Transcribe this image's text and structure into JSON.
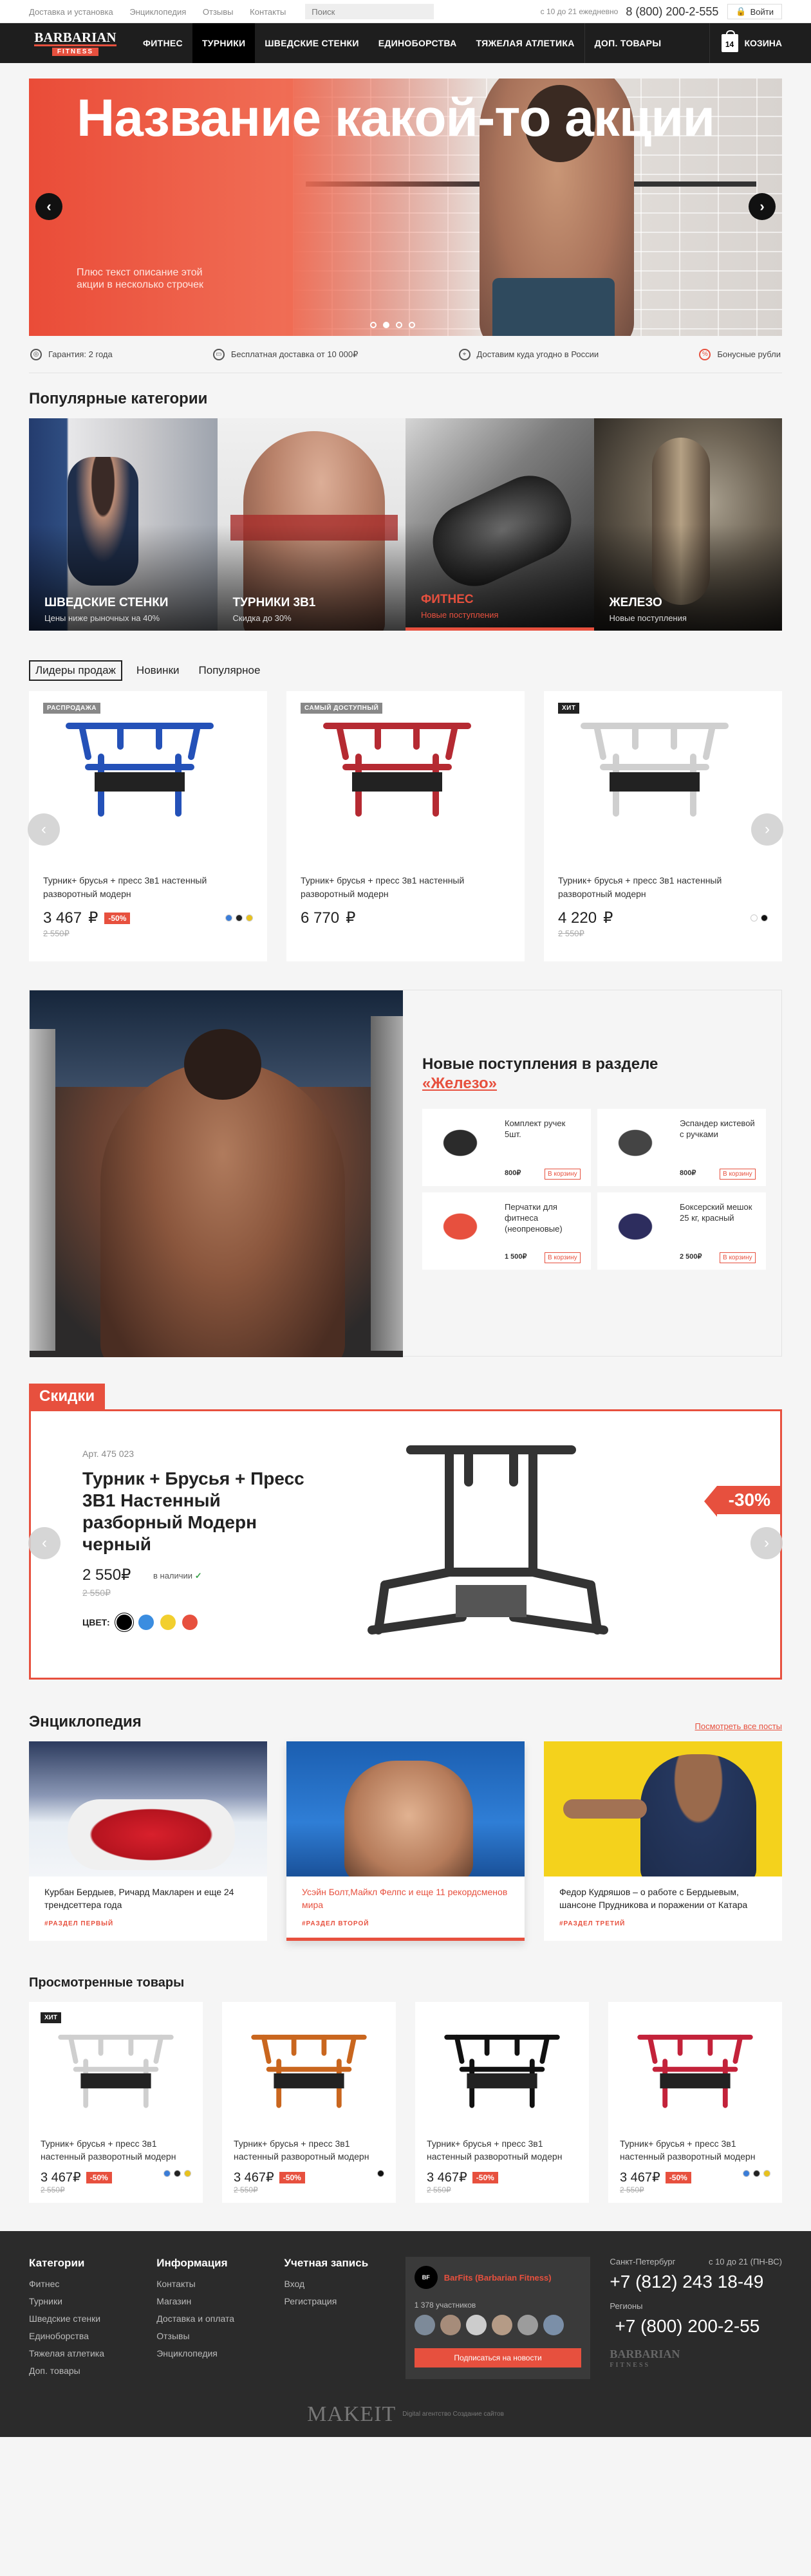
{
  "topbar": {
    "links": [
      "Доставка и установка",
      "Энциклопедия",
      "Отзывы",
      "Контакты"
    ],
    "search_placeholder": "Поиск",
    "hours": "с 10 до 21 ежедневно",
    "phone": "8 (800) 200-2-555",
    "login": "Войти"
  },
  "logo": {
    "line1": "BARBARIAN",
    "line2": "FITNESS"
  },
  "nav": {
    "items": [
      "ФИТНЕС",
      "ТУРНИКИ",
      "ШВЕДСКИЕ СТЕНКИ",
      "ЕДИНОБОРСТВА",
      "ТЯЖЕЛАЯ АТЛЕТИКА",
      "ДОП. ТОВАРЫ"
    ],
    "active": "ТУРНИКИ",
    "cart_count": "14",
    "cart_label": "КОЗИНА"
  },
  "hero": {
    "title": "Название какой-то акции",
    "subtitle": "Плюс текст описание этой акции в несколько строчек",
    "slides": 4,
    "active_slide": 2
  },
  "benefits": [
    "Гарантия: 2 года",
    "Бесплатная доставка от 10 000₽",
    "Доставим куда угодно в России",
    "Бонусные рубли"
  ],
  "categories": {
    "title": "Популярные категории",
    "items": [
      {
        "name": "ШВЕДСКИЕ СТЕНКИ",
        "sub": "Цены ниже рыночных на 40%"
      },
      {
        "name": "ТУРНИКИ 3В1",
        "sub": "Скидка до 30%"
      },
      {
        "name": "ФИТНЕС",
        "sub": "Новые поступления"
      },
      {
        "name": "ЖЕЛЕЗО",
        "sub": "Новые поступления"
      }
    ]
  },
  "tabs": [
    "Лидеры продаж",
    "Новинки",
    "Популярное"
  ],
  "products": [
    {
      "badge": "РАСПРОДАЖА",
      "name": "Турник+ брусья + пресс 3в1 настенный разворотный модерн",
      "price": "3 467",
      "discount": "-50%",
      "old": "2 550₽",
      "color": "#2451b8",
      "colors": [
        "#3b7dd8",
        "#222",
        "#e8c21e"
      ]
    },
    {
      "badge": "САМЫЙ ДОСТУПНЫЙ",
      "name": "Турник+ брусья + пресс 3в1 настенный разворотный модерн",
      "price": "6 770",
      "discount": "",
      "old": "",
      "color": "#b52a32",
      "colors": []
    },
    {
      "badge": "ХИТ",
      "name": "Турник+ брусья + пресс 3в1 настенный разворотный модерн",
      "price": "4 220",
      "discount": "",
      "old": "2 550₽",
      "color": "#eeeeee",
      "colors": [
        "#fff",
        "#111"
      ]
    }
  ],
  "currency": "₽",
  "newarr": {
    "title": "Новые поступления в разделе",
    "link": "«Железо»",
    "items": [
      {
        "name": "Комплект ручек 5шт.",
        "price": "800₽",
        "btn": "В корзину"
      },
      {
        "name": "Эспандер кистевой с ручками",
        "price": "800₽",
        "btn": "В корзину"
      },
      {
        "name": "Перчатки для фитнеса (неопреновые)",
        "price": "1 500₽",
        "btn": "В корзину"
      },
      {
        "name": "Боксерский мешок 25 кг, красный",
        "price": "2 500₽",
        "btn": "В корзину"
      }
    ]
  },
  "sale": {
    "head": "Скидки",
    "art": "Арт. 475 023",
    "name": "Турник + Брусья + Пресс 3В1 Настенный разборный Модерн черный",
    "price": "2 550",
    "instock": "в наличии",
    "old": "2 550₽",
    "color_label": "ЦВЕТ:",
    "colors": [
      "#000",
      "#3b8de0",
      "#f2cf2e",
      "#e7503e"
    ],
    "discount": "-30%"
  },
  "ency": {
    "title": "Энциклопедия",
    "all": "Посмотреть все посты",
    "items": [
      {
        "title": "Курбан Бердыев, Ричард Макларен и еще 24 трендсеттера года",
        "kind": "#РАЗДЕЛ ПЕРВЫЙ"
      },
      {
        "title": "Усэйн Болт,Майкл Фелпс и еще 11 рекордсменов мира",
        "kind": "#РАЗДЕЛ ВТОРОЙ"
      },
      {
        "title": "Федор Кудряшов – о работе с Бердыевым, шансоне Прудникова и поражении от Катара",
        "kind": "#РАЗДЕЛ ТРЕТИЙ"
      }
    ]
  },
  "viewed": {
    "title": "Просмотренные товары",
    "items": [
      {
        "badge": "ХИТ",
        "name": "Турник+ брусья + пресс 3в1 настенный разворотный модерн",
        "price": "3 467₽",
        "discount": "-50%",
        "old": "2 550₽",
        "color": "#dddddd",
        "colors": [
          "#3b7dd8",
          "#222",
          "#e8c21e"
        ]
      },
      {
        "badge": "",
        "name": "Турник+ брусья + пресс 3в1 настенный разворотный модерн",
        "price": "3 467₽",
        "discount": "-50%",
        "old": "2 550₽",
        "color": "#c9661e",
        "colors": [
          "#111"
        ]
      },
      {
        "badge": "",
        "name": "Турник+ брусья + пресс 3в1 настенный разворотный модерн",
        "price": "3 467₽",
        "discount": "-50%",
        "old": "2 550₽",
        "color": "#111111",
        "colors": []
      },
      {
        "badge": "",
        "name": "Турник+ брусья + пресс 3в1 настенный разворотный модерн",
        "price": "3 467₽",
        "discount": "-50%",
        "old": "2 550₽",
        "color": "#c3223a",
        "colors": [
          "#3b7dd8",
          "#222",
          "#e8c21e"
        ]
      }
    ]
  },
  "footer": {
    "cols": [
      {
        "title": "Категории",
        "items": [
          "Фитнес",
          "Турники",
          "Шведские стенки",
          "Единоборства",
          "Тяжелая атлетика",
          "Доп. товары"
        ]
      },
      {
        "title": "Информация",
        "items": [
          "Контакты",
          "Магазин",
          "Доставка и оплата",
          "Отзывы",
          "Энциклопедия"
        ]
      },
      {
        "title": "Учетная запись",
        "items": [
          "Вход",
          "Регистрация"
        ]
      }
    ],
    "vk": {
      "name": "BarFits (Barbarian Fitness)",
      "count": "1 378 участников",
      "btn": "Подписаться на новости"
    },
    "city": "Санкт-Петербург",
    "hours": "с 10 до 21 (ПН-ВС)",
    "phone1": "+7 (812) 243 18-49",
    "regions": "Регионы",
    "phone2": "+7 (800) 200-2-55",
    "logo1": "BARBARIAN",
    "logo2": "FITNESS",
    "maker": "MAKEIT",
    "maker_sub": "Digital агентство Создание сайтов"
  }
}
